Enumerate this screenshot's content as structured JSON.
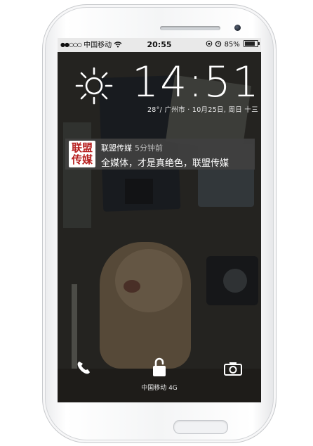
{
  "status_bar": {
    "signal_dots": "●●○○○",
    "carrier": "中国移动",
    "time": "20:55",
    "battery_text": "85%",
    "battery_level": 0.85
  },
  "lock_screen": {
    "clock": "14:51",
    "date_line": "28°/ 广州市 · 10月25日, 周日 十三",
    "weather_icon": "sun-icon"
  },
  "notification": {
    "app_icon_lines": [
      "联盟",
      "传媒"
    ],
    "app_name": "联盟传媒",
    "time_ago": "5分钟前",
    "message": "全媒体，才是真绝色，联盟传媒"
  },
  "bottom": {
    "phone_icon": "phone-icon",
    "lock_icon": "unlock-icon",
    "camera_icon": "camera-icon",
    "carrier_label": "中国移动 4G"
  },
  "colors": {
    "status_bar_bg": "#e9e9e9",
    "notification_bg": "#404040",
    "app_icon_text": "#b61e1e",
    "lockscreen_text": "#ffffff"
  }
}
